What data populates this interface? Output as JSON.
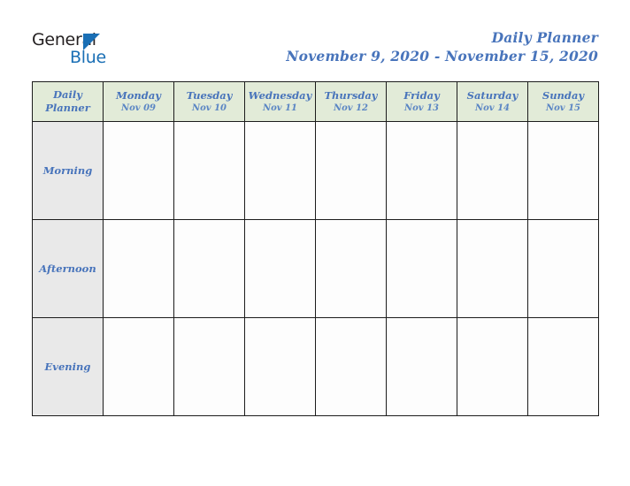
{
  "logo": {
    "word_top": "General",
    "word_bottom": "Blue",
    "triangle_color": "#1a6fb5"
  },
  "header": {
    "title": "Daily Planner",
    "date_range": "November 9, 2020 - November 15, 2020",
    "accent_color": "#4874bb"
  },
  "table": {
    "corner_label_line1": "Daily",
    "corner_label_line2": "Planner",
    "header_background": "#e2ebd8",
    "label_background": "#e9e9e9",
    "days": [
      {
        "name": "Monday",
        "date": "Nov 09"
      },
      {
        "name": "Tuesday",
        "date": "Nov 10"
      },
      {
        "name": "Wednesday",
        "date": "Nov 11"
      },
      {
        "name": "Thursday",
        "date": "Nov 12"
      },
      {
        "name": "Friday",
        "date": "Nov 13"
      },
      {
        "name": "Saturday",
        "date": "Nov 14"
      },
      {
        "name": "Sunday",
        "date": "Nov 15"
      }
    ],
    "slots": [
      {
        "label": "Morning",
        "entries": [
          "",
          "",
          "",
          "",
          "",
          "",
          ""
        ]
      },
      {
        "label": "Afternoon",
        "entries": [
          "",
          "",
          "",
          "",
          "",
          "",
          ""
        ]
      },
      {
        "label": "Evening",
        "entries": [
          "",
          "",
          "",
          "",
          "",
          "",
          ""
        ]
      }
    ]
  }
}
